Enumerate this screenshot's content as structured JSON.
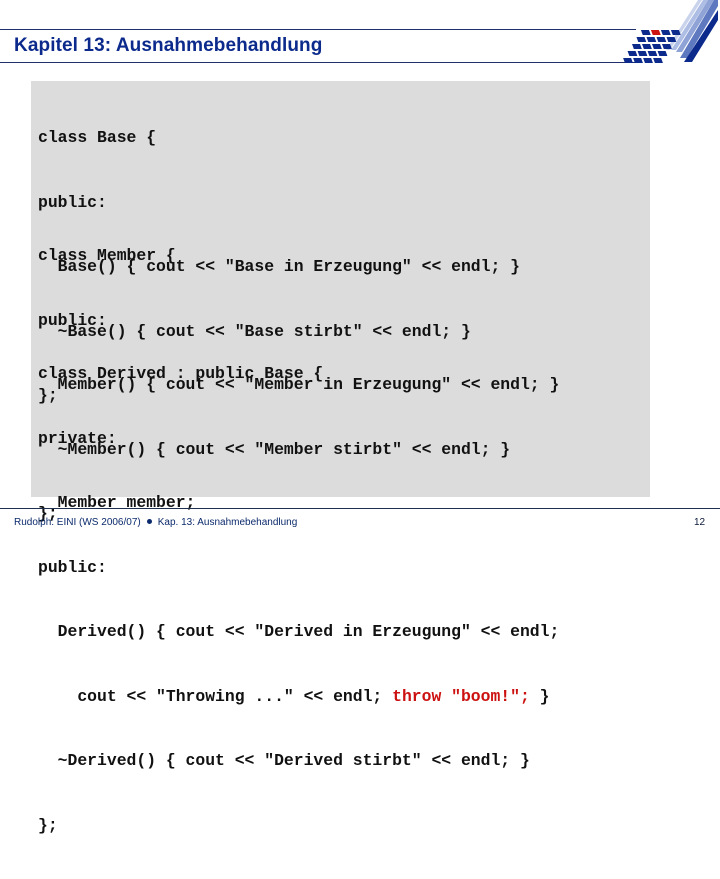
{
  "header": {
    "title": "Kapitel 13: Ausnahmebehandlung"
  },
  "logo": {
    "icon": "university-logo-icon",
    "colors": {
      "primary": "#0b2a8c",
      "accent": "#cc1111",
      "light": "#8fa3d6"
    }
  },
  "code": {
    "blocks": [
      {
        "name": "base",
        "lines": [
          "class Base {",
          "public:",
          "  Base() { cout << \"Base in Erzeugung\" << endl; }",
          "  ~Base() { cout << \"Base stirbt\" << endl; }",
          "};"
        ]
      },
      {
        "name": "member",
        "lines": [
          "class Member {",
          "public:",
          "  Member() { cout << \"Member in Erzeugung\" << endl; }",
          "  ~Member() { cout << \"Member stirbt\" << endl; }",
          "};"
        ]
      },
      {
        "name": "derived",
        "lines": [
          "class Derived : public Base {",
          "private:",
          "  Member member;",
          "public:",
          "  Derived() { cout << \"Derived in Erzeugung\" << endl;",
          "    cout << \"Throwing ...\" << endl; ",
          "  ~Derived() { cout << \"Derived stirbt\" << endl; }",
          "};"
        ],
        "highlight": {
          "line_index": 5,
          "text": "throw \"boom!\";",
          "after": " }",
          "color": "#cc1111"
        }
      }
    ]
  },
  "footer": {
    "left_part1": "Rudolph: EINI (WS 2006/07)",
    "left_part2": "Kap. 13: Ausnahmebehandlung",
    "page_number": "12"
  }
}
